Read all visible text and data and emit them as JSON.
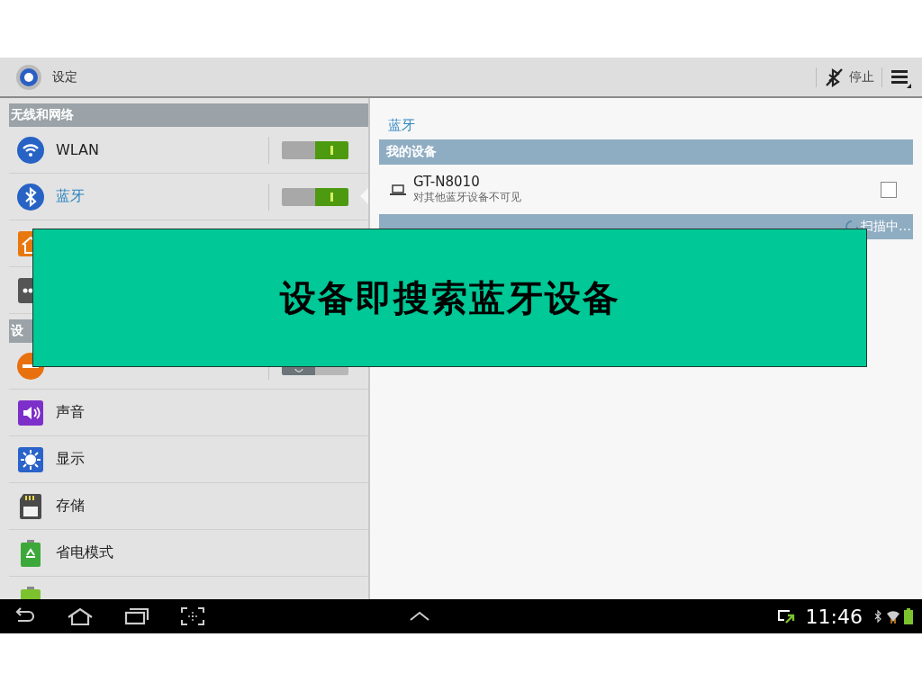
{
  "action_bar": {
    "title": "设定",
    "stop_label": "停止"
  },
  "sidebar": {
    "sections": [
      {
        "header": "无线和网络",
        "items": [
          {
            "label": "WLAN",
            "kind": "toggle",
            "on": true,
            "selected": false
          },
          {
            "label": "蓝牙",
            "kind": "toggle",
            "on": true,
            "selected": true
          },
          {
            "kind": "plain"
          },
          {
            "kind": "plain"
          }
        ]
      },
      {
        "header": "设",
        "items": [
          {
            "kind": "toggle",
            "on": false,
            "selected": false
          },
          {
            "label": "声音",
            "kind": "plain",
            "selected": false
          },
          {
            "label": "显示",
            "kind": "plain",
            "selected": false
          },
          {
            "label": "存储",
            "kind": "plain",
            "selected": false
          },
          {
            "label": "省电模式",
            "kind": "plain",
            "selected": false
          },
          {
            "kind": "plain",
            "selected": false
          }
        ]
      }
    ]
  },
  "detail": {
    "title": "蓝牙",
    "my_devices": {
      "header": "我的设备",
      "devices": [
        {
          "name": "GT-N8010",
          "status": "对其他蓝牙设备不可见",
          "checked": false
        }
      ]
    },
    "available": {
      "scan_status": "扫描中…"
    }
  },
  "nav_bar": {
    "time": "11:46"
  },
  "caption": "设备即搜索蓝牙设备"
}
